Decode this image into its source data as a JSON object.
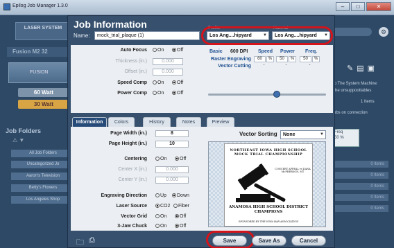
{
  "window": {
    "title": "Epilog Job Manager 1.3.0"
  },
  "background": {
    "left": {
      "laser_system": "LASER SYSTEM",
      "machine": "Fusion M2 32",
      "laser_img_label": "FUSION",
      "watts": [
        "60 Watt",
        "30 Watt"
      ],
      "job_folders_title": "Job Folders",
      "sort_icons": "⚠ ▼",
      "folders": [
        "All Job Folders",
        "Uncategorized Jo",
        "Aaron's Television",
        "Betty's Flowers",
        "Los Angeles Shop"
      ]
    },
    "right": {
      "text1": "Fo The System Machine:",
      "text2": "b he unsuppoottables",
      "items_count": "1 Items",
      "job_category": "Jobs on connection",
      "table_hdr1": "Freq",
      "table_v1": "50",
      "table_v2": "%",
      "rows": [
        "0 Items",
        "0 Items",
        "0 Items",
        "0 Items",
        "0 Items"
      ]
    }
  },
  "dialog": {
    "title": "Job Information",
    "name_label": "Name:",
    "name_value": "mock_trial_plaque (1)",
    "profile_small_1": "Profile",
    "profile_small_2": "Material",
    "select1": "Los Ang....hipyard",
    "select2": "Los Ang....hipyard",
    "settings": {
      "auto_focus": {
        "label": "Auto Focus",
        "on": "On",
        "off": "Off"
      },
      "thickness": {
        "label": "Thickness (in.)",
        "value": "0.000"
      },
      "offset": {
        "label": "Offset (in.)",
        "value": "0.000"
      },
      "speed_comp": {
        "label": "Speed Comp",
        "on": "On",
        "off": "Off"
      },
      "power_comp": {
        "label": "Power Comp",
        "on": "On",
        "off": "Off"
      }
    },
    "process_table": {
      "basic": "Basic",
      "dpi": "600 DPI",
      "headers": [
        "Speed",
        "Power",
        "Freq."
      ],
      "raster_label": "Raster Engraving",
      "raster_values": [
        "60",
        "%",
        "50",
        "%",
        "50",
        "%"
      ],
      "vector_label": "Vector Cutting",
      "vector_values": [
        "-",
        "-",
        "-"
      ]
    },
    "tabs": [
      "Information",
      "Colors",
      "History",
      "Notes",
      "Preview"
    ],
    "info": {
      "page_width": {
        "label": "Page Width (in.)",
        "value": "8"
      },
      "page_height": {
        "label": "Page Height (in.)",
        "value": "10"
      },
      "centering": {
        "label": "Centering",
        "on": "On",
        "off": "Off"
      },
      "center_x": {
        "label": "Center X (in.)",
        "value": "0.000"
      },
      "center_y": {
        "label": "Center Y (in.)",
        "value": "0.000"
      },
      "engraving_direction": {
        "label": "Engraving Direction",
        "opt1": "Up",
        "opt2": "Down"
      },
      "laser_source": {
        "label": "Laser Source",
        "opt1": "CO2",
        "opt2": "Fiber"
      },
      "vector_grid": {
        "label": "Vector Grid",
        "on": "On",
        "off": "Off"
      },
      "jaw_chuck": {
        "label": "3-Jaw Chuck",
        "on": "On",
        "off": "Off"
      },
      "diameter": {
        "label": "Diameter (in.)",
        "value": "0.000"
      }
    },
    "vector_sorting": {
      "label": "Vector Sorting",
      "value": "None"
    },
    "preview_doc": {
      "heading": "NORTHEAST IOWA HIGH SCHOOL MOCK TRIAL CHAMPIONSHIP",
      "small": "CONCERT APPEAL vs DANA McPHERSON, MT",
      "school": "ANAMOSA HIGH SCHOOL DISTRICT CHAMPIONS",
      "footer": "SPONSORED BY THE IOWA BAR ASSOCIATION"
    },
    "buttons": {
      "save": "Save",
      "save_as": "Save As",
      "cancel": "Cancel"
    }
  },
  "colors": {
    "highlight": "#d4141a",
    "dialog_bg": "#36506e",
    "active_tab": "#274b78",
    "accent_blue": "#1d4f91"
  }
}
